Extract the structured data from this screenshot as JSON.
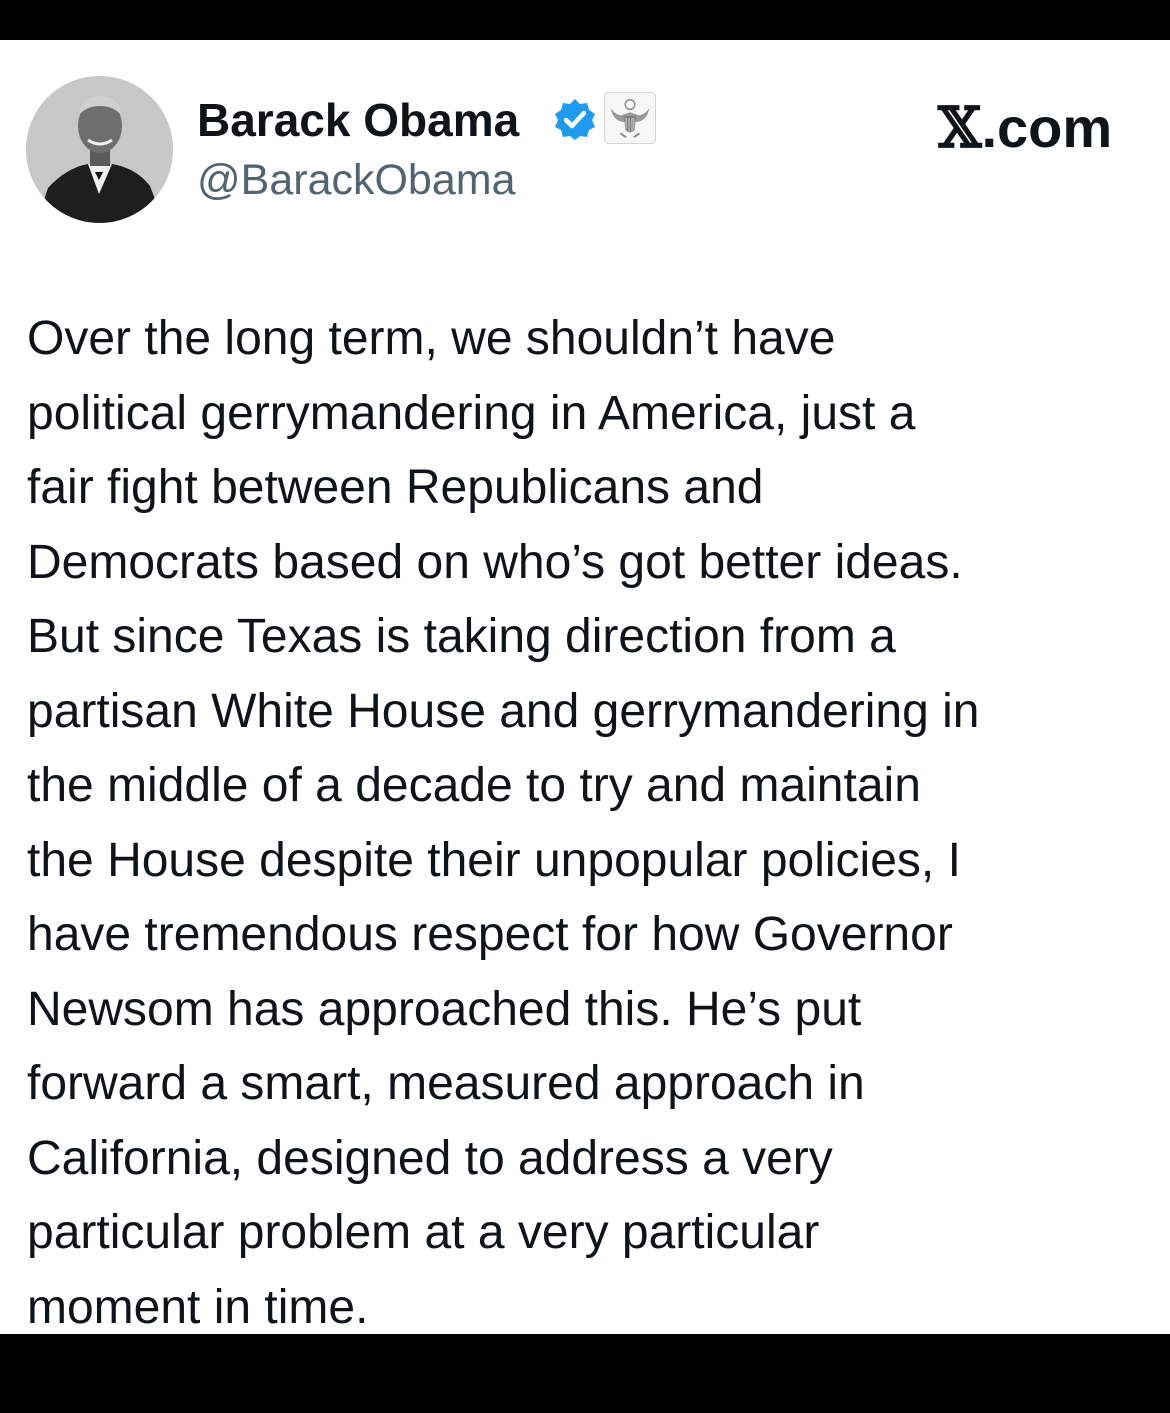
{
  "post": {
    "author": {
      "display_name": "Barack Obama",
      "handle": "@BarackObama",
      "verified_badge_icon": "verified-check-icon",
      "affiliation_badge_icon": "government-seal-icon"
    },
    "source_brand": "X.com",
    "text_lines": [
      "Over the long term, we shouldn’t have",
      "political gerrymandering in America, just a",
      "fair fight between Republicans and",
      "Democrats based on who’s got better ideas.",
      "But since Texas is taking direction from a",
      "partisan White House and gerrymandering in",
      "the middle of a decade to try and maintain",
      "the House despite their unpopular policies, I",
      "have tremendous respect for how Governor",
      "Newsom has approached this. He’s put",
      "forward a smart, measured approach in",
      "California, designed to address a very",
      "particular problem at a very particular",
      "moment in time."
    ]
  },
  "colors": {
    "frame": "#000000",
    "card_background": "#ffffff",
    "primary_text": "#0f1419",
    "secondary_text": "#536471",
    "verified_blue": "#1d9bf0"
  }
}
